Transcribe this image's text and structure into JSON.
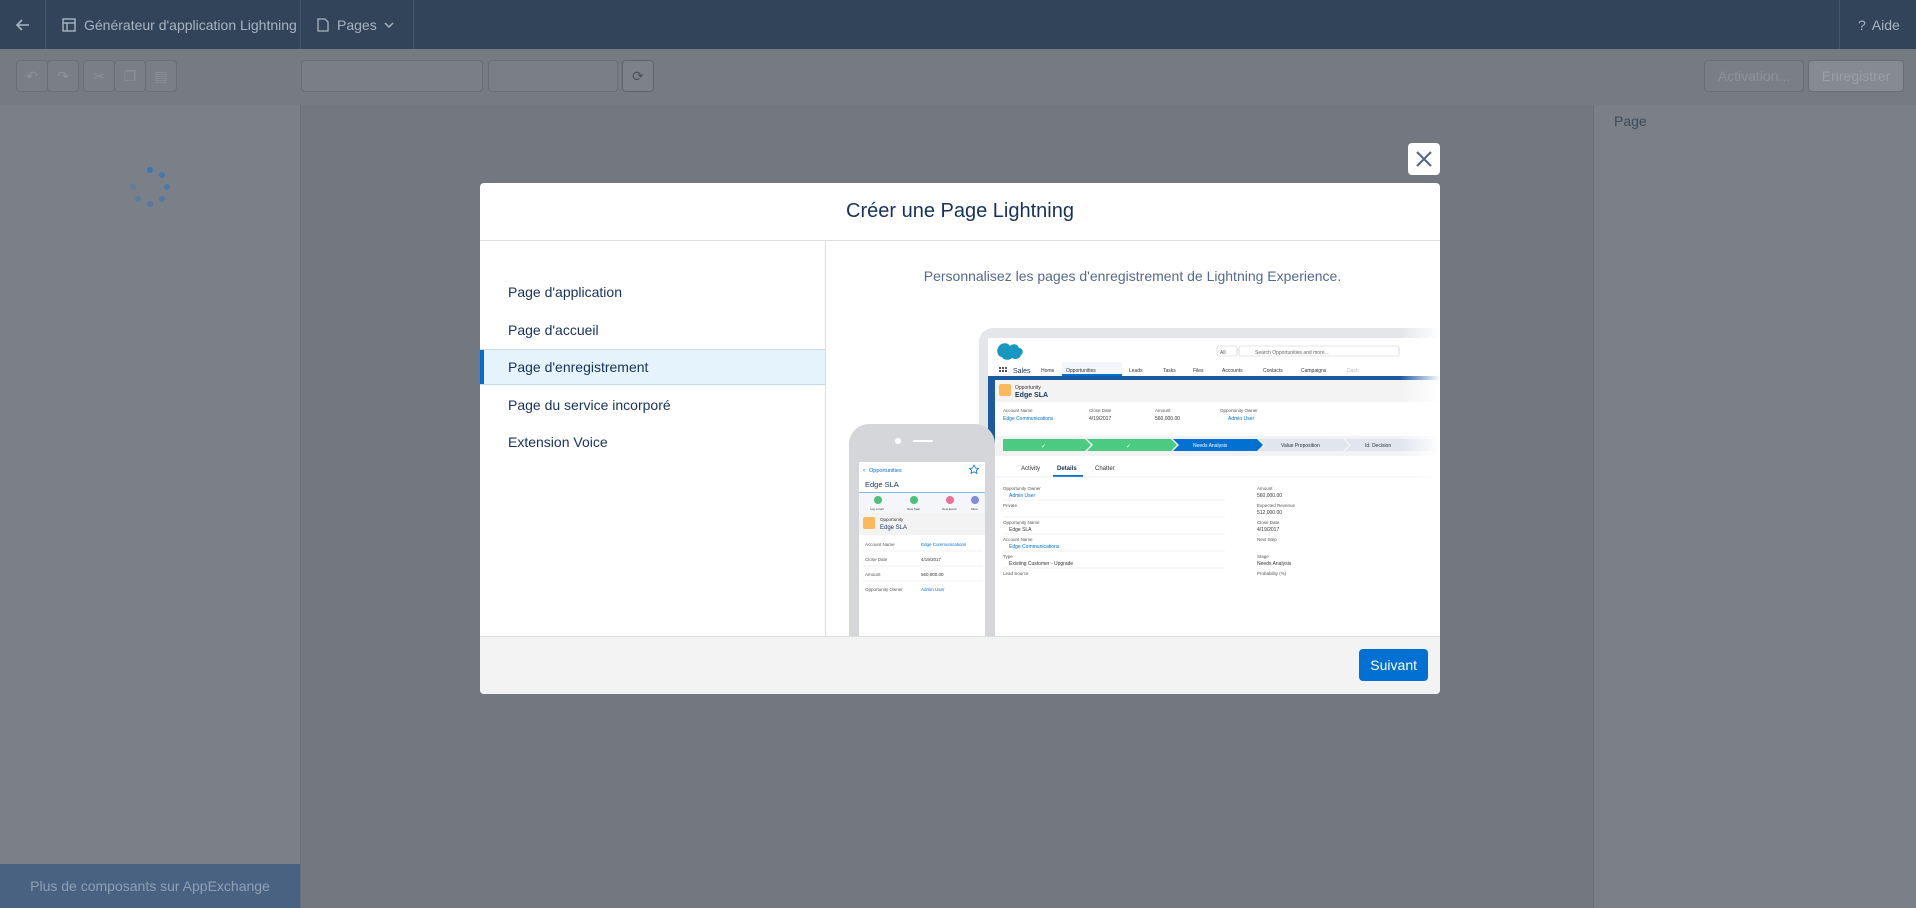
{
  "topbar": {
    "back_icon": "arrow-left-icon",
    "app_title": "Générateur d'application Lightning",
    "pages_label": "Pages",
    "help_label": "Aide"
  },
  "toolbar": {
    "activation_label": "Activation...",
    "save_label": "Enregistrer"
  },
  "right_panel": {
    "title": "Page"
  },
  "left_panel": {
    "appexchange_label": "Plus de composants sur AppExchange"
  },
  "modal": {
    "title": "Créer une Page Lightning",
    "nav_items": [
      {
        "label": "Page d'application"
      },
      {
        "label": "Page d'accueil"
      },
      {
        "label": "Page d'enregistrement"
      },
      {
        "label": "Page du service incorporé"
      },
      {
        "label": "Extension Voice"
      }
    ],
    "selected_index": 2,
    "description": "Personnalisez les pages d'enregistrement de Lightning Experience.",
    "next_label": "Suivant"
  },
  "preview": {
    "desktop": {
      "search_scope": "All",
      "search_placeholder": "Search Opportunities and more...",
      "app_name": "Sales",
      "nav": [
        "Home",
        "Opportunities",
        "Leads",
        "Tasks",
        "Files",
        "Accounts",
        "Contacts",
        "Campaigns",
        "Dash"
      ],
      "object_label": "Opportunity",
      "record_name": "Edge SLA",
      "fields": [
        {
          "label": "Account Name",
          "value": "Edge Communications"
        },
        {
          "label": "Close Date",
          "value": "4/19/2017"
        },
        {
          "label": "Amount",
          "value": "560,000.00"
        },
        {
          "label": "Opportunity Owner",
          "value": "Admin User"
        }
      ],
      "path_steps": [
        "✓",
        "✓",
        "Needs Analysis",
        "Value Proposition",
        "Id. Decision"
      ],
      "tabs": [
        "Activity",
        "Details",
        "Chatter"
      ],
      "left_col": [
        {
          "label": "Opportunity Owner",
          "value": "Admin User"
        },
        {
          "label": "Private",
          "value": ""
        },
        {
          "label": "Opportunity Name",
          "value": "Edge SLA"
        },
        {
          "label": "Account Name",
          "value": "Edge Communications"
        },
        {
          "label": "Type",
          "value": "Existing Customer - Upgrade"
        },
        {
          "label": "Lead Source",
          "value": ""
        }
      ],
      "right_col": [
        {
          "label": "Amount",
          "value": "560,000.00"
        },
        {
          "label": "Expected Revenue",
          "value": "512,000.00"
        },
        {
          "label": "Close Date",
          "value": "4/19/2017"
        },
        {
          "label": "Next Step",
          "value": ""
        },
        {
          "label": "Stage",
          "value": "Needs Analysis"
        },
        {
          "label": "Probability (%)",
          "value": ""
        }
      ]
    },
    "mobile": {
      "back_label": "Opportunities",
      "record_title": "Edge SLA",
      "actions": [
        "Log a Call",
        "New Task",
        "New Event",
        "More"
      ],
      "object_label": "Opportunity",
      "record_name": "Edge SLA",
      "fields": [
        {
          "label": "Account Name",
          "value": "Edge Communications"
        },
        {
          "label": "Close Date",
          "value": "4/19/2017"
        },
        {
          "label": "Amount",
          "value": "560,000.00"
        },
        {
          "label": "Opportunity Owner",
          "value": "Admin User"
        }
      ]
    }
  },
  "colors": {
    "brand_blue": "#0070d2",
    "header_dark": "#32445a",
    "text_navy": "#16325c",
    "path_green": "#4bca81",
    "path_active": "#0070d2"
  }
}
